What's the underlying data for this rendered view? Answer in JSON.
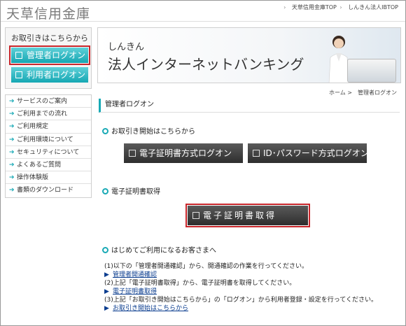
{
  "header": {
    "bank_name": "天草信用金庫",
    "links": [
      "天草信用金庫TOP",
      "しんきん法人IBTOP"
    ]
  },
  "sidebar": {
    "login_title": "お取引きはこちらから",
    "admin_login": "管理者ログオン",
    "user_login": "利用者ログオン",
    "menu": [
      "サービスのご案内",
      "ご利用までの流れ",
      "ご利用規定",
      "ご利用環境について",
      "セキュリティについて",
      "よくあるご質問",
      "操作体験版",
      "書類のダウンロード"
    ]
  },
  "banner": {
    "small": "しんきん",
    "big": "法人インターネットバンキング"
  },
  "breadcrumb": "ホーム >　管理者ログオン",
  "page_title": "管理者ログオン",
  "sections": {
    "start": "お取引き開始はこちらから",
    "cert": "電子証明書取得",
    "first": "はじめてご利用になるお客さまへ"
  },
  "buttons": {
    "cert_login": "電子証明書方式ログオン",
    "id_login": "ID･パスワード方式ログオン",
    "cert_get": "電子証明書取得"
  },
  "info": {
    "step1": "(1)以下の「管理者開通確認」から、開通確認の作業を行ってください。",
    "link1": "管理者開通確認",
    "step2": "(2)上記「電子証明書取得」から、電子証明書を取得してください。",
    "link2": "電子証明書取得",
    "step3": "(3)上記「お取引き開始はこちらから」の「ログオン」から利用者登録・設定を行ってください。",
    "link3": "お取引き開始はこちらから"
  },
  "colors": {
    "accent": "#18a9b5",
    "highlight": "#c8262b",
    "dark_button": "#3a3a3a"
  }
}
